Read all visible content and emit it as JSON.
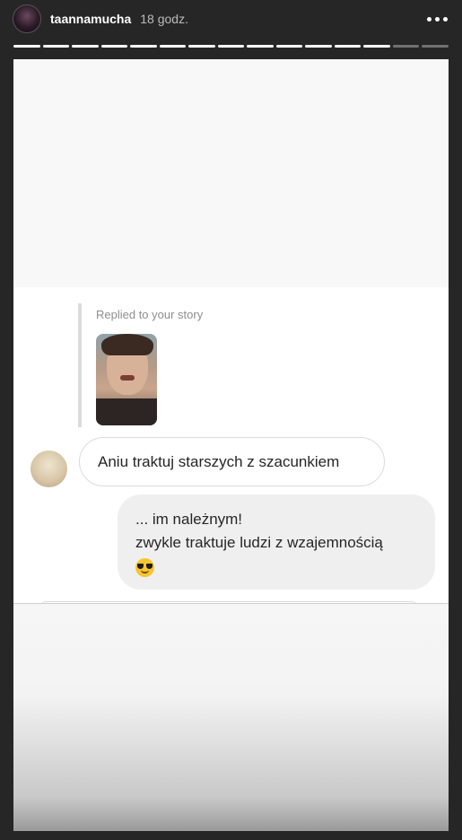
{
  "header": {
    "username": "taannamucha",
    "time": "18 godz.",
    "avatar_icon": "profile-avatar",
    "more_icon": "more-dots-icon"
  },
  "progress": {
    "segments": 15,
    "completed": 13
  },
  "message": {
    "reply_label": "Replied to your story",
    "incoming_text": "Aniu traktuj starszych z szacunkiem",
    "outgoing_line1": "... im należnym!",
    "outgoing_line2": "zwykle traktuje ludzi z wzajemnością",
    "outgoing_emoji": "smiling-face-with-sunglasses"
  }
}
